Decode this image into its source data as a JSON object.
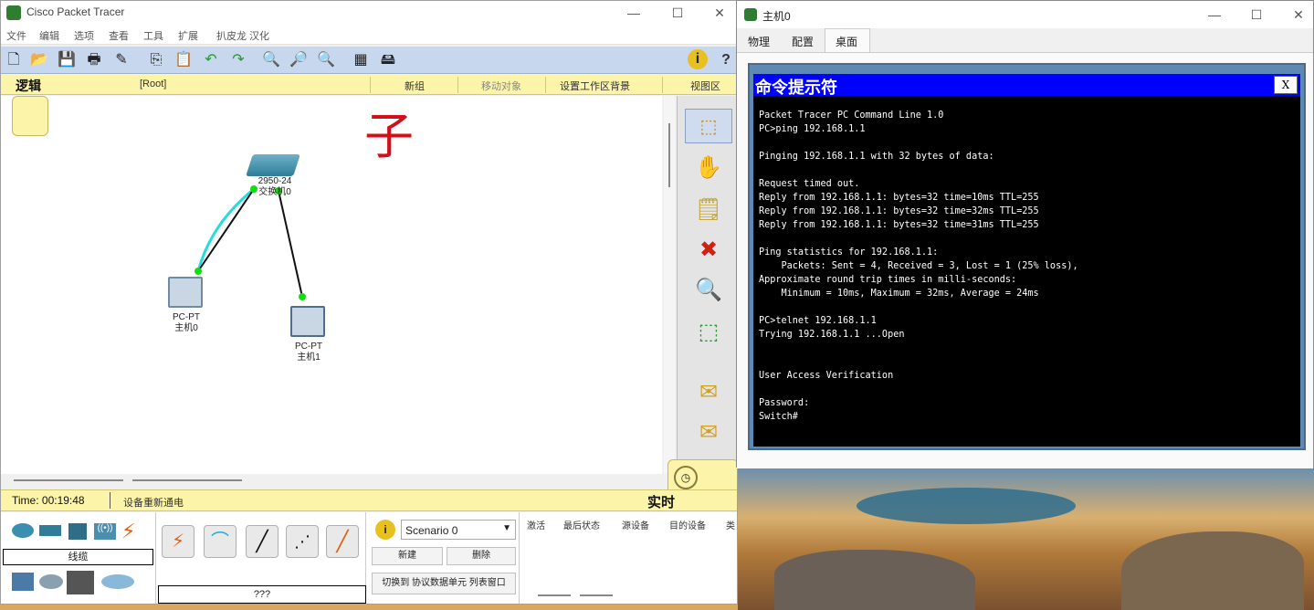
{
  "pt_window": {
    "title": "Cisco Packet Tracer",
    "menu": [
      "文件",
      "编辑",
      "选项",
      "查看",
      "工具",
      "扩展",
      "扒皮龙 汉化"
    ],
    "ws_bar": {
      "logic_tab": "逻辑",
      "root": "[Root]",
      "new_cluster": "新组",
      "move_object": "移动对象",
      "set_bg": "设置工作区背景",
      "viewport": "视图区"
    },
    "annotation": "子",
    "devices": {
      "switch": {
        "model": "2950-24",
        "name": "交换机0"
      },
      "pc0": {
        "model": "PC-PT",
        "name": "主机0"
      },
      "pc1": {
        "model": "PC-PT",
        "name": "主机1"
      }
    },
    "status": {
      "time": "Time: 00:19:48",
      "power_cycle": "设备重新通电",
      "realtime": "实时"
    },
    "bottom": {
      "category_label": "线缆",
      "cable_label": "???",
      "scenario": "Scenario 0",
      "new_btn": "新建",
      "delete_btn": "删除",
      "toggle_btn": "切换到 协议数据单元 列表窗口",
      "pdu_columns": [
        "激活",
        "最后状态",
        "源设备",
        "目的设备",
        "类"
      ]
    },
    "icons": {
      "toolbar": [
        "new-icon",
        "open-icon",
        "save-icon",
        "print-icon",
        "wizard-icon",
        "copy-icon",
        "paste-icon",
        "undo-icon",
        "redo-icon",
        "zoom-in-icon",
        "zoom-reset-icon",
        "zoom-out-icon",
        "palette-icon",
        "custom-device-icon",
        "info-icon",
        "help-icon"
      ]
    },
    "colors": {
      "toolbar": "#c7d7ee",
      "ws_bar": "#fcf4a9",
      "link_green": "#11dd11",
      "link_cyan": "#22dddd",
      "title_blue": "#0000ff"
    }
  },
  "cmd_window": {
    "title": "主机0",
    "tabs": [
      "物理",
      "配置",
      "桌面"
    ],
    "cmd_title": "命令提示符",
    "close_label": "X",
    "lines": [
      "Packet Tracer PC Command Line 1.0",
      "PC>ping 192.168.1.1",
      "",
      "Pinging 192.168.1.1 with 32 bytes of data:",
      "",
      "Request timed out.",
      "Reply from 192.168.1.1: bytes=32 time=10ms TTL=255",
      "Reply from 192.168.1.1: bytes=32 time=32ms TTL=255",
      "Reply from 192.168.1.1: bytes=32 time=31ms TTL=255",
      "",
      "Ping statistics for 192.168.1.1:",
      "    Packets: Sent = 4, Received = 3, Lost = 1 (25% loss),",
      "Approximate round trip times in milli-seconds:",
      "    Minimum = 10ms, Maximum = 32ms, Average = 24ms",
      "",
      "PC>telnet 192.168.1.1",
      "Trying 192.168.1.1 ...Open",
      "",
      "",
      "User Access Verification",
      "",
      "Password: ",
      "Switch#"
    ]
  }
}
